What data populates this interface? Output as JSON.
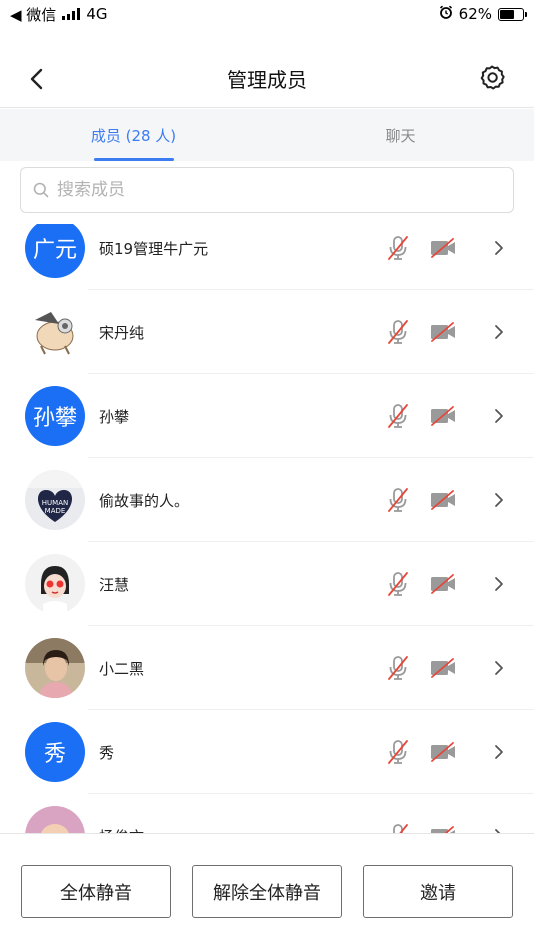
{
  "status_bar": {
    "back_app": "◀ 微信",
    "network": "4G",
    "battery_percent": "62%",
    "battery_level": 0.62
  },
  "header": {
    "title": "管理成员"
  },
  "tabs": [
    {
      "label": "成员 (28 人)",
      "active": true
    },
    {
      "label": "聊天",
      "active": false
    }
  ],
  "search": {
    "placeholder": "搜索成员"
  },
  "members": [
    {
      "name": "硕19管理牛广元",
      "avatar_type": "text",
      "avatar_text": "广元"
    },
    {
      "name": "宋丹纯",
      "avatar_type": "image",
      "avatar_icon": "cartoon-pet-avatar"
    },
    {
      "name": "孙攀",
      "avatar_type": "text",
      "avatar_text": "孙攀"
    },
    {
      "name": "偷故事的人。",
      "avatar_type": "image",
      "avatar_icon": "human-made-heart-avatar"
    },
    {
      "name": "汪慧",
      "avatar_type": "image",
      "avatar_icon": "cartoon-girl-avatar"
    },
    {
      "name": "小二黑",
      "avatar_type": "image",
      "avatar_icon": "photo-avatar"
    },
    {
      "name": "秀",
      "avatar_type": "text",
      "avatar_text": "秀"
    },
    {
      "name": "杨俊文",
      "avatar_type": "image",
      "avatar_icon": "baby-photo-avatar"
    }
  ],
  "actions": {
    "mute_all": "全体静音",
    "unmute_all": "解除全体静音",
    "invite": "邀请"
  },
  "colors": {
    "accent": "#3c7cf2",
    "avatar_blue": "#1a6ff5",
    "muted_red": "#e5483b"
  }
}
